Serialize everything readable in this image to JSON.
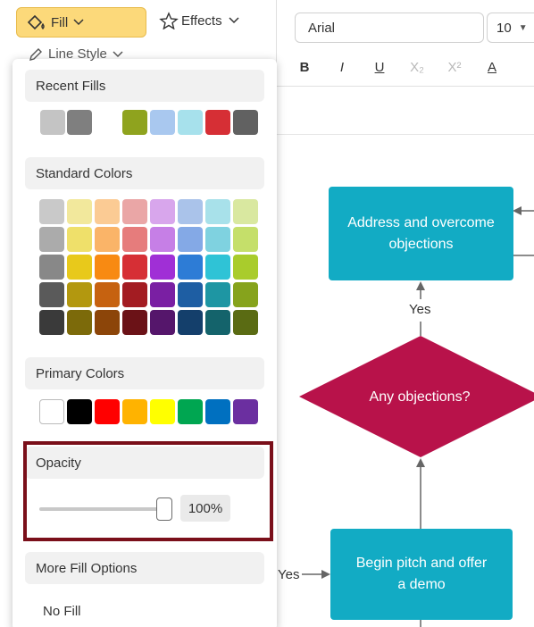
{
  "toolbar": {
    "fill_label": "Fill",
    "effects_label": "Effects",
    "line_style_label": "Line Style",
    "font_family": "Arial",
    "font_size": "10",
    "format_buttons": [
      {
        "label": "B",
        "icon": "bold-icon",
        "enabled": true
      },
      {
        "label": "I",
        "icon": "italic-icon",
        "enabled": true
      },
      {
        "label": "U",
        "icon": "underline-icon",
        "enabled": true
      },
      {
        "label": "X₂",
        "icon": "subscript-icon",
        "enabled": false
      },
      {
        "label": "X²",
        "icon": "superscript-icon",
        "enabled": false
      },
      {
        "label": "A",
        "icon": "text-color-icon",
        "enabled": true
      }
    ]
  },
  "fill_panel": {
    "recent_fills": {
      "title": "Recent Fills",
      "colors": [
        "#c4c4c4",
        "#7f7f7f",
        "",
        "#8fa31e",
        "#a9c8ef",
        "#a7e1ec",
        "#d62f35",
        "#616161"
      ]
    },
    "standard_colors": {
      "title": "Standard Colors",
      "rows": [
        [
          "#c9c9c9",
          "#f2e89c",
          "#fbcb94",
          "#eaa6a6",
          "#d8a6ec",
          "#aac3ea",
          "#a8e1ea",
          "#d9e8a0"
        ],
        [
          "#ababab",
          "#efe06a",
          "#fab468",
          "#e67c7c",
          "#c67fe6",
          "#84a9e6",
          "#7fd2e0",
          "#c5df6a"
        ],
        [
          "#888888",
          "#e8c91b",
          "#f88a12",
          "#d62f35",
          "#a02fd6",
          "#2d7cd6",
          "#2fc3d6",
          "#a9cc2c"
        ],
        [
          "#5a5a5a",
          "#b3980f",
          "#c66210",
          "#a31c22",
          "#7a1fa3",
          "#1e5ea3",
          "#1e96a3",
          "#86a31c"
        ],
        [
          "#3a3a3a",
          "#7c6a0a",
          "#8c4509",
          "#6b1217",
          "#55166b",
          "#143f6b",
          "#14636b",
          "#5a6b13"
        ]
      ]
    },
    "primary_colors": {
      "title": "Primary Colors",
      "colors": [
        "#ffffff",
        "#000000",
        "#ff0000",
        "#ffb300",
        "#ffff00",
        "#00a651",
        "#0070c0",
        "#6b2fa0"
      ]
    },
    "opacity": {
      "title": "Opacity",
      "value_label": "100%",
      "level": 1.0
    },
    "more_fill_options": "More Fill Options",
    "no_fill": "No Fill"
  },
  "diagram": {
    "nodes": [
      {
        "label": "Address and overcome objections",
        "shape": "rectangle",
        "color": "#12abc4"
      },
      {
        "label": "Any objections?",
        "shape": "diamond",
        "color": "#b8124a"
      },
      {
        "label": "Begin pitch and offer a demo",
        "shape": "rectangle",
        "color": "#12abc4"
      }
    ],
    "edge_labels": [
      "Yes",
      "Yes"
    ]
  }
}
